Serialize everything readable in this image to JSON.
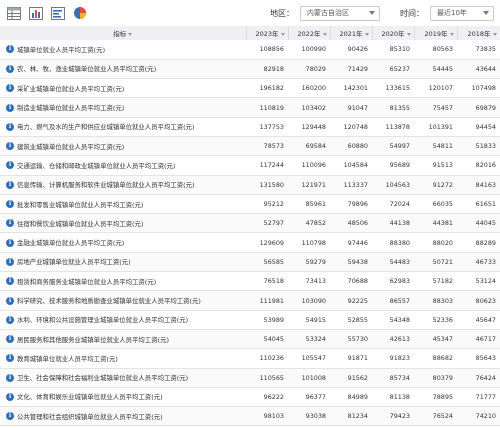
{
  "toolbar": {
    "icons": [
      "table-icon",
      "bar-chart-icon",
      "list-bar-icon",
      "pie-chart-icon"
    ],
    "region_label": "地区：",
    "region_value": "内蒙古自治区",
    "time_label": "时间：",
    "time_value": "最近10年"
  },
  "table": {
    "header": [
      "指标",
      "2023年",
      "2022年",
      "2021年",
      "2020年",
      "2019年",
      "2018年"
    ],
    "rows": [
      {
        "name": "城镇单位就业人员平均工资(元)",
        "values": [
          "108856",
          "100990",
          "90426",
          "85310",
          "80563",
          "73835"
        ]
      },
      {
        "name": "农、林、牧、渔业城镇单位就业人员平均工资(元)",
        "values": [
          "82918",
          "78029",
          "71429",
          "65237",
          "54445",
          "43644"
        ]
      },
      {
        "name": "采矿业城镇单位就业人员平均工资(元)",
        "values": [
          "196182",
          "160200",
          "142301",
          "133615",
          "120107",
          "107498"
        ]
      },
      {
        "name": "制造业城镇单位就业人员平均工资(元)",
        "values": [
          "110819",
          "103402",
          "91047",
          "81355",
          "75457",
          "69879"
        ]
      },
      {
        "name": "电力、燃气及水的生产和供应业城镇单位就业人员平均工资(元)",
        "values": [
          "137753",
          "129448",
          "120748",
          "113878",
          "101391",
          "94454"
        ]
      },
      {
        "name": "建筑业城镇单位就业人员平均工资(元)",
        "values": [
          "78573",
          "69584",
          "60880",
          "54997",
          "54811",
          "51833"
        ]
      },
      {
        "name": "交通运输、仓储和邮政业城镇单位就业人员平均工资(元)",
        "values": [
          "117244",
          "110096",
          "104584",
          "95689",
          "91513",
          "82016"
        ]
      },
      {
        "name": "信息传输、计算机服务和软件业城镇单位就业人员平均工资(元)",
        "values": [
          "131580",
          "121971",
          "113337",
          "104563",
          "91272",
          "84163"
        ]
      },
      {
        "name": "批发和零售业城镇单位就业人员平均工资(元)",
        "values": [
          "95212",
          "85961",
          "79896",
          "72024",
          "66035",
          "61651"
        ]
      },
      {
        "name": "住宿和餐饮业城镇单位就业人员平均工资(元)",
        "values": [
          "52797",
          "47852",
          "48506",
          "44138",
          "44381",
          "44045"
        ]
      },
      {
        "name": "金融业城镇单位就业人员平均工资(元)",
        "values": [
          "129609",
          "110798",
          "97446",
          "88380",
          "88020",
          "88289"
        ]
      },
      {
        "name": "房地产业城镇单位就业人员平均工资(元)",
        "values": [
          "56585",
          "59279",
          "59438",
          "54483",
          "50721",
          "46733"
        ]
      },
      {
        "name": "租赁和商务服务业城镇单位就业人员平均工资(元)",
        "values": [
          "76518",
          "73413",
          "70688",
          "62983",
          "57182",
          "53124"
        ]
      },
      {
        "name": "科学研究、技术服务和地质勘查业城镇单位就业人员平均工资(元)",
        "values": [
          "111981",
          "103090",
          "92225",
          "86557",
          "88303",
          "80623"
        ]
      },
      {
        "name": "水利、环境和公共设施管理业城镇单位就业人员平均工资(元)",
        "values": [
          "53989",
          "54915",
          "52855",
          "54348",
          "52336",
          "45647"
        ]
      },
      {
        "name": "居民服务和其他服务业城镇单位就业人员平均工资(元)",
        "values": [
          "54045",
          "53324",
          "55730",
          "42613",
          "45347",
          "46717"
        ]
      },
      {
        "name": "教育城镇单位就业人员平均工资(元)",
        "values": [
          "110236",
          "105547",
          "91871",
          "91823",
          "88682",
          "85643"
        ]
      },
      {
        "name": "卫生、社会保障和社会福利业城镇单位就业人员平均工资(元)",
        "values": [
          "110565",
          "101008",
          "91562",
          "85734",
          "80379",
          "76424"
        ]
      },
      {
        "name": "文化、体育和娱乐业城镇单位就业人员平均工资(元)",
        "values": [
          "96222",
          "96377",
          "84989",
          "81138",
          "78895",
          "71777"
        ]
      },
      {
        "name": "公共管理和社会组织城镇单位就业人员平均工资(元)",
        "values": [
          "98103",
          "93038",
          "81234",
          "79423",
          "76524",
          "74210"
        ]
      }
    ]
  }
}
